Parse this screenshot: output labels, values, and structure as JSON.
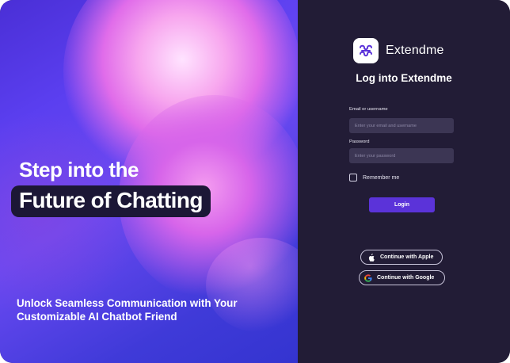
{
  "hero": {
    "headline_line1": "Step into the",
    "headline_line2": "Future of Chatting",
    "subtitle_line1": "Unlock Seamless Communication with Your",
    "subtitle_line2": "Customizable AI Chatbot Friend"
  },
  "brand": {
    "name": "Extendme",
    "logo_icon": "extendme-logo-icon"
  },
  "login": {
    "title": "Log into Extendme",
    "email_label": "Email or username",
    "email_placeholder": "Enter your email and username",
    "email_value": "",
    "password_label": "Password",
    "password_placeholder": "Enter your password",
    "password_value": "",
    "remember_label": "Remember me",
    "remember_checked": false,
    "submit_label": "Login",
    "apple_label": "Continue with Apple",
    "apple_icon": "apple-icon",
    "google_label": "Continue with Google",
    "google_icon": "google-icon"
  },
  "colors": {
    "panel_bg": "#221c36",
    "input_bg": "#3c3654",
    "accent": "#5b33d9",
    "hero_base": "#5b3ff0",
    "hero_glow": "#f49cf0"
  }
}
